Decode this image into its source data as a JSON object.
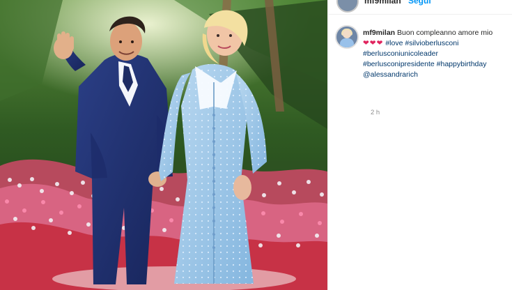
{
  "header_strip": {
    "username": "mf9milan",
    "follow_label": "Segui"
  },
  "post": {
    "caption_user": "mf9milan",
    "caption_text": "Buon compleanno amore mio",
    "hearts": "❤❤❤",
    "hashtags": [
      "#love",
      "#silvioberlusconi",
      "#berlusconiunicoleader",
      "#berlusconipresidente",
      "#happybirthday"
    ],
    "mention": "@alessandrarich",
    "timestamp": "2 h"
  },
  "colors": {
    "hashtag": "#00376b",
    "heart": "#e0245e",
    "link_blue": "#0095f6",
    "timestamp": "#8e8e8e"
  }
}
